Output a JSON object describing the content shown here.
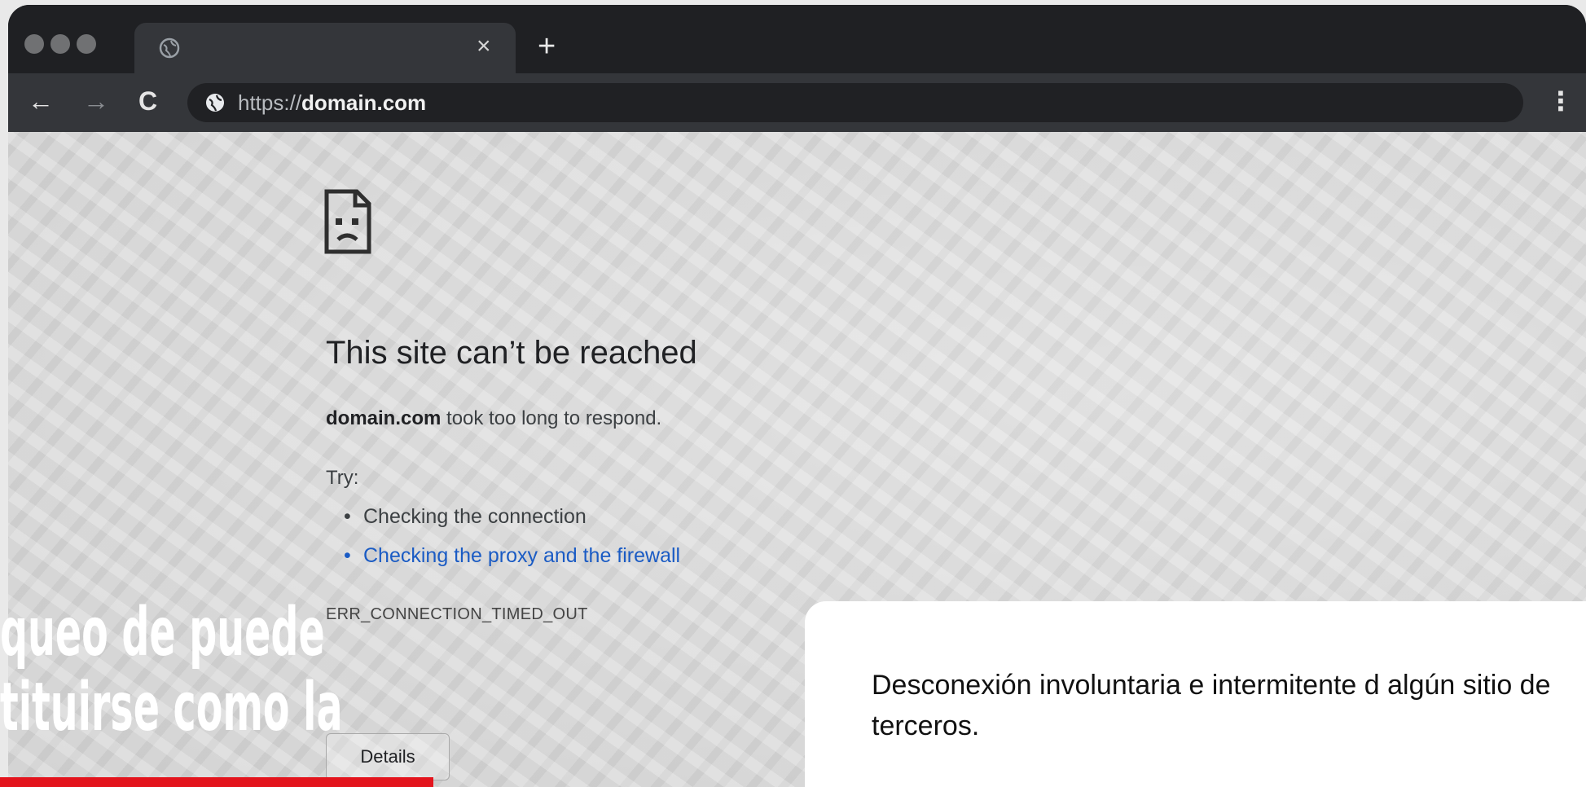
{
  "browser": {
    "tab": {
      "title": "",
      "close_glyph": "×"
    },
    "new_tab_glyph": "+",
    "nav": {
      "back_glyph": "←",
      "forward_glyph": "→",
      "reload_glyph": "C"
    },
    "url_prefix": "https://",
    "url_domain": "domain.com",
    "menu_glyph": "⋮",
    "window_dot_colors": [
      "#707173",
      "#707173",
      "#707173"
    ]
  },
  "error_page": {
    "icon": "sad-page-icon",
    "title": "This site can’t be reached",
    "desc_domain": "domain.com",
    "desc_rest": " took too long to respond.",
    "try_label": "Try:",
    "suggestions": [
      "Checking the connection",
      "Checking the proxy and the firewall"
    ],
    "suggestion_link_color": "#1a5bc4",
    "error_code": "ERR_CONNECTION_TIMED_OUT",
    "details_label": "Details"
  },
  "overlay": {
    "headline_line1": "queo de puede",
    "headline_line2": "tituirse como la",
    "accent_color": "#e3141d",
    "caption": "Desconexión involuntaria e intermitente d algún sitio de terceros."
  }
}
